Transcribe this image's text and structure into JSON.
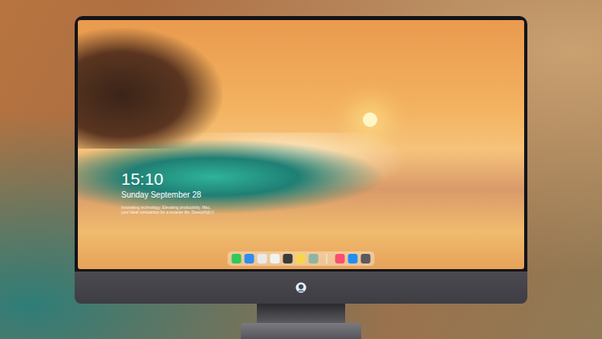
{
  "lock_screen": {
    "time": "15:10",
    "date": "Sunday September 28",
    "tagline": "Innovating technology, Elevating productivity. Mac, your ideal companion for a smarter life. Deeeplh设计"
  },
  "dock": {
    "apps": [
      {
        "color": "#34c759"
      },
      {
        "color": "#2f8cf0"
      },
      {
        "color": "#e9e9ea"
      },
      {
        "color": "#f2f2f2"
      },
      {
        "color": "#3a3a3c"
      },
      {
        "color": "#f7d64a"
      },
      {
        "color": "#8fb5a0"
      }
    ],
    "extras": [
      {
        "color": "#fa4f6f"
      },
      {
        "color": "#1f8ef5"
      },
      {
        "color": "#5a5a60"
      }
    ]
  }
}
